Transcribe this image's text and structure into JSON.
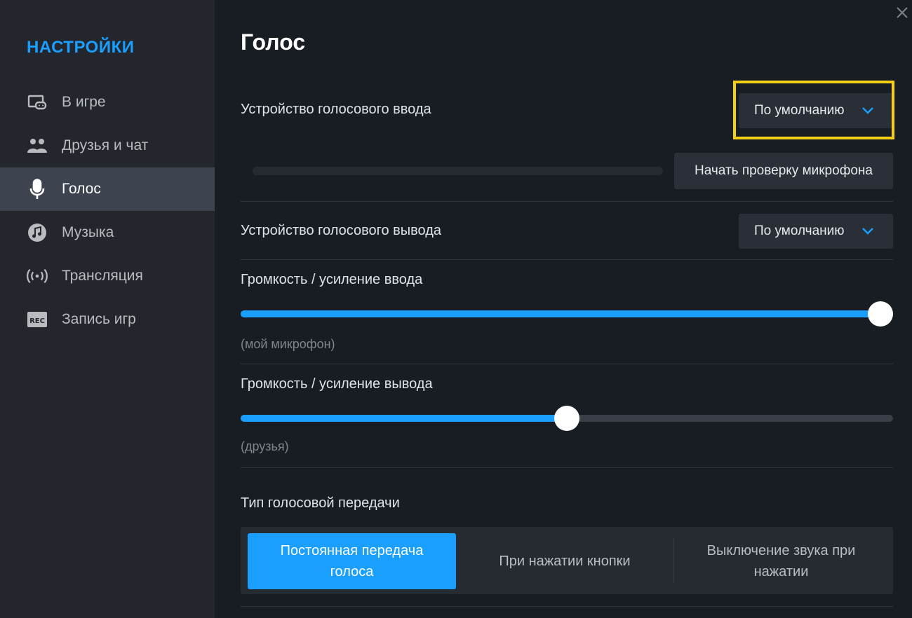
{
  "sidebar": {
    "title": "НАСТРОЙКИ",
    "items": [
      {
        "label": "В игре",
        "icon": "gamepad-screen-icon",
        "active": false
      },
      {
        "label": "Друзья и чат",
        "icon": "friends-icon",
        "active": false
      },
      {
        "label": "Голос",
        "icon": "microphone-icon",
        "active": true
      },
      {
        "label": "Музыка",
        "icon": "music-icon",
        "active": false
      },
      {
        "label": "Трансляция",
        "icon": "broadcast-icon",
        "active": false
      },
      {
        "label": "Запись игр",
        "icon": "rec-icon",
        "active": false
      }
    ]
  },
  "main": {
    "title": "Голос",
    "input_device": {
      "label": "Устройство голосового ввода",
      "value": "По умолчанию"
    },
    "mic_test_button": "Начать проверку микрофона",
    "output_device": {
      "label": "Устройство голосового вывода",
      "value": "По умолчанию"
    },
    "input_volume": {
      "label": "Громкость / усиление ввода",
      "hint": "(мой микрофон)",
      "value": 1.0
    },
    "output_volume": {
      "label": "Громкость / усиление вывода",
      "hint": "(друзья)",
      "value": 0.5
    },
    "transmission": {
      "label": "Тип голосовой передачи",
      "options": [
        "Постоянная передача голоса",
        "При нажатии кнопки",
        "Выключение звука при нажатии"
      ],
      "selected": 0
    }
  },
  "colors": {
    "accent": "#1a9fff",
    "highlight": "#f5cf12",
    "sidebar_bg": "#23262d",
    "main_bg": "#181d24"
  }
}
